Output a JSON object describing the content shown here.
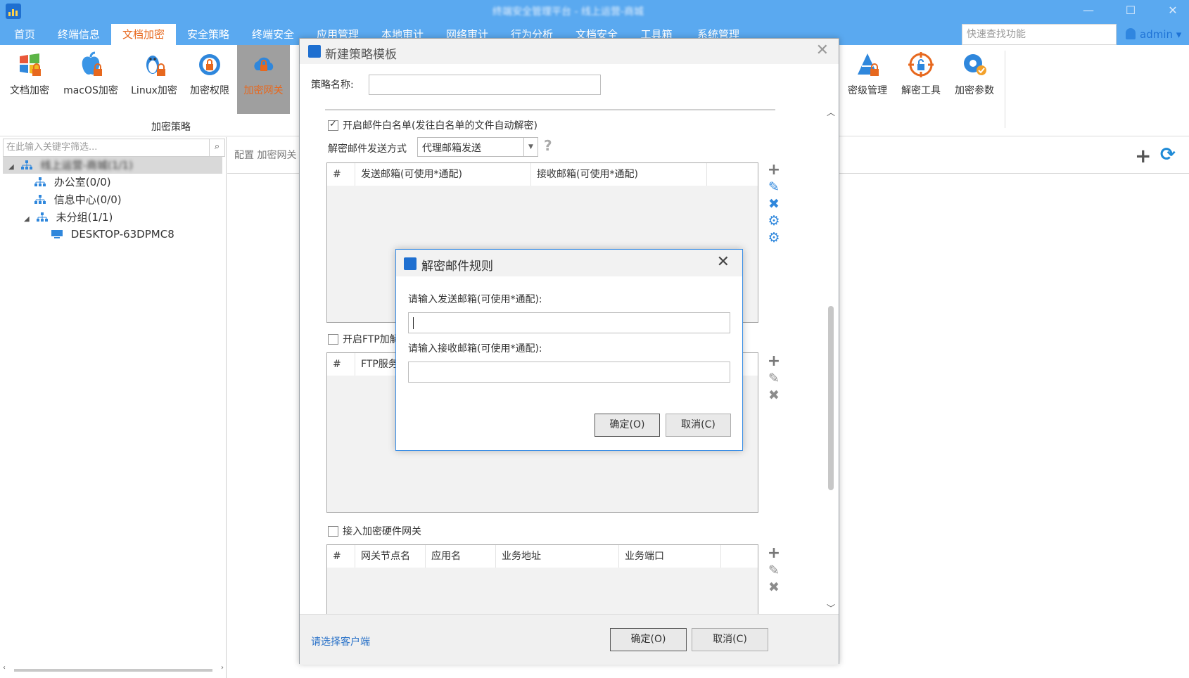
{
  "window": {
    "title": "终端安全管理平台 - 线上运营-商城"
  },
  "menu": {
    "items": [
      "首页",
      "终端信息",
      "文档加密",
      "安全策略",
      "终端安全",
      "应用管理",
      "本地审计",
      "网络审计",
      "行为分析",
      "文档安全",
      "工具箱",
      "系统管理"
    ],
    "active_index": 2,
    "quick_search_placeholder": "快速查找功能",
    "user": "admin"
  },
  "ribbon": {
    "buttons": [
      "文档加密",
      "macOS加密",
      "Linux加密",
      "加密权限",
      "加密网关",
      "密级管理",
      "解密工具",
      "加密参数"
    ],
    "active_index": 4,
    "group_label": "加密策略"
  },
  "left_panel": {
    "filter_placeholder": "在此输入关键字筛选...",
    "tree": [
      {
        "label": "线上运营-商城(1/1)",
        "level": 0,
        "toggle": "◢",
        "selected": true,
        "blurred": true
      },
      {
        "label": "办公室(0/0)",
        "level": 1,
        "toggle": "",
        "selected": false,
        "blurred": false
      },
      {
        "label": "信息中心(0/0)",
        "level": 1,
        "toggle": "",
        "selected": false,
        "blurred": false
      },
      {
        "label": "未分组(1/1)",
        "level": 1,
        "toggle": "◢",
        "selected": false,
        "blurred": false
      },
      {
        "label": "DESKTOP-63DPMC8",
        "level": 2,
        "toggle": "",
        "selected": false,
        "blurred": false,
        "computer": true
      }
    ]
  },
  "main": {
    "breadcrumb": "配置 加密网关"
  },
  "dialog": {
    "title": "新建策略模板",
    "name_label": "策略名称:",
    "name_value": "",
    "mail_whitelist": {
      "label": "开启邮件白名单(发往白名单的文件自动解密)",
      "checked": true
    },
    "send_mode_label": "解密邮件发送方式",
    "send_mode_value": "代理邮箱发送",
    "help": "?",
    "mail_grid_columns": [
      "#",
      "发送邮箱(可使用*通配)",
      "接收邮箱(可使用*通配)"
    ],
    "ftp": {
      "label": "开启FTP加解密",
      "checked": false
    },
    "ftp_grid_columns": [
      "#",
      "FTP服务器"
    ],
    "hw_gateway": {
      "label": "接入加密硬件网关",
      "checked": false
    },
    "hw_grid_columns": [
      "#",
      "网关节点名",
      "应用名",
      "业务地址",
      "业务端口"
    ],
    "footer_link": "请选择客户端",
    "ok_label": "确定(O)",
    "cancel_label": "取消(C)"
  },
  "subdialog": {
    "title": "解密邮件规则",
    "sender_label": "请输入发送邮箱(可使用*通配):",
    "sender_value": "",
    "receiver_label": "请输入接收邮箱(可使用*通配):",
    "receiver_value": "",
    "ok_label": "确定(O)",
    "cancel_label": "取消(C)"
  },
  "colors": {
    "accent": "#5aa9f0",
    "active_text": "#e7681e",
    "link": "#2a72c8",
    "icon_blue": "#2f87dc"
  }
}
